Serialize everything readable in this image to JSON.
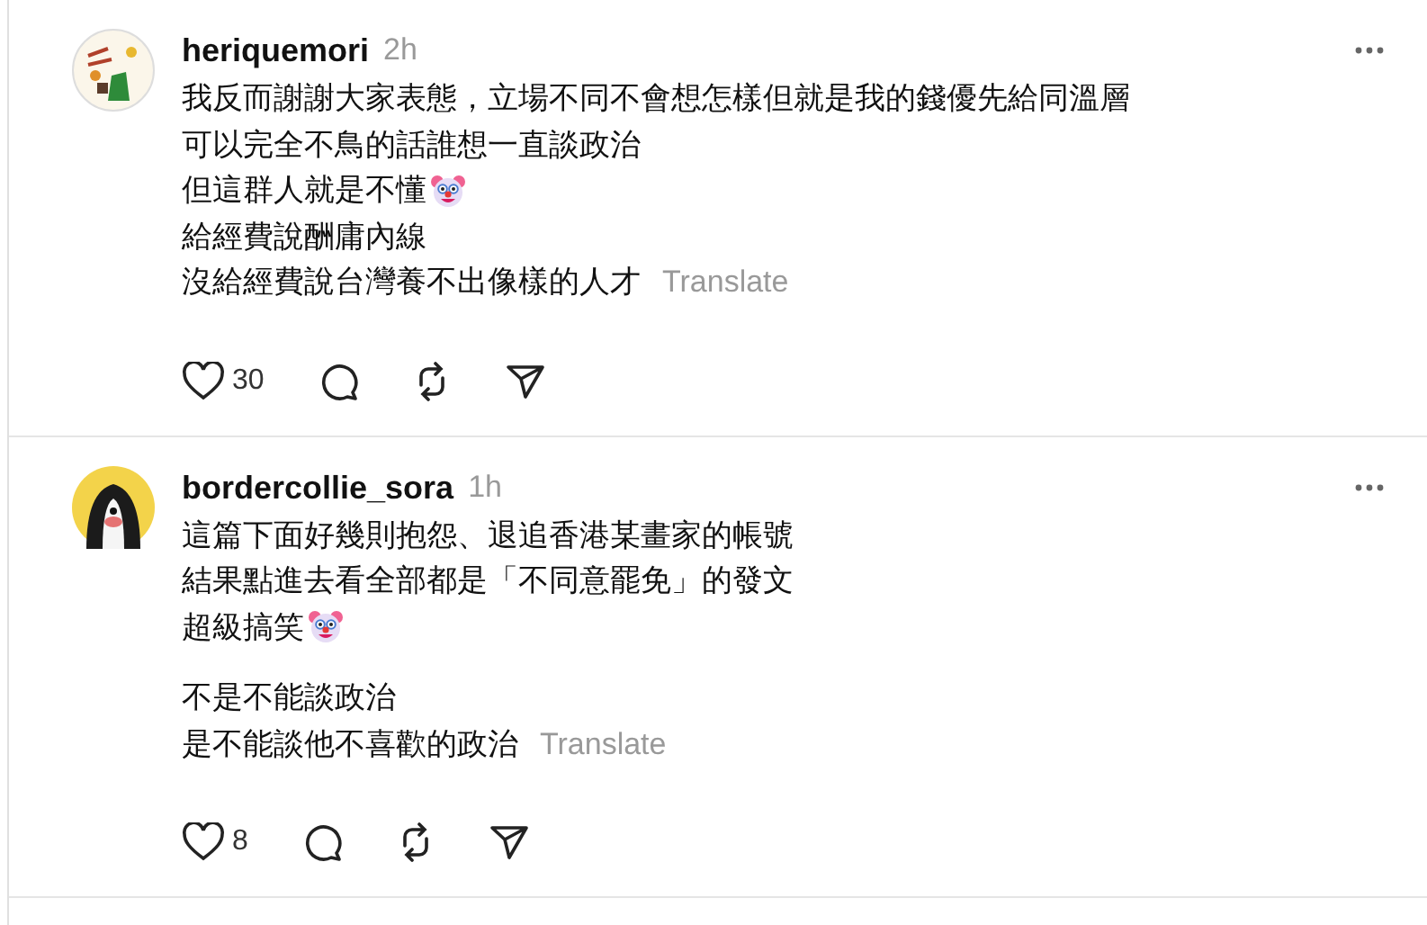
{
  "posts": [
    {
      "username": "heriquemori",
      "time": "2h",
      "paragraphs": [
        [
          {
            "text": "我反而謝謝大家表態，立場不同不會想怎樣但就是我的錢優先給同溫層",
            "kind": "plain"
          },
          {
            "text": "可以完全不鳥的話誰想一直談政治",
            "kind": "plain"
          },
          {
            "text": "但這群人就是不懂",
            "kind": "emoji"
          },
          {
            "text": "給經費說酬庸內線",
            "kind": "plain"
          },
          {
            "text": "沒給經費說台灣養不出像樣的人才",
            "kind": "plain"
          }
        ]
      ],
      "translate": "Translate",
      "likes": "30"
    },
    {
      "username": "bordercollie_sora",
      "time": "1h",
      "paragraphs": [
        [
          {
            "text": "這篇下面好幾則抱怨、退追香港某畫家的帳號",
            "kind": "plain"
          },
          {
            "text": "結果點進去看全部都是「不同意罷免」的發文",
            "kind": "plain"
          },
          {
            "text": "超級搞笑",
            "kind": "emoji"
          }
        ],
        [
          {
            "text": "不是不能談政治",
            "kind": "plain"
          },
          {
            "text": "是不能談他不喜歡的政治",
            "kind": "plain"
          }
        ]
      ],
      "translate": "Translate",
      "likes": "8"
    }
  ]
}
